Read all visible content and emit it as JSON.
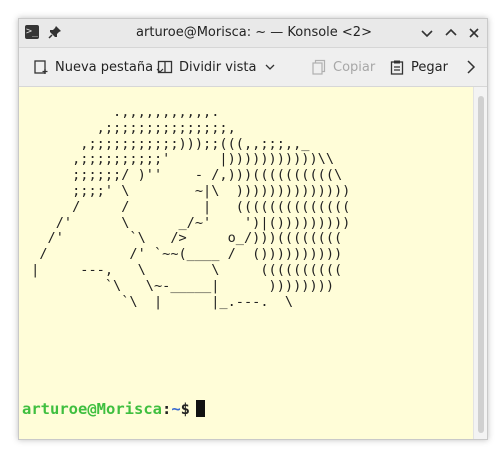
{
  "window": {
    "title": "arturoe@Morisca: ~ — Konsole <2>"
  },
  "toolbar": {
    "new_tab_label": "Nueva pestaña",
    "split_view_label": "Dividir vista",
    "copy_label": "Copiar",
    "paste_label": "Pegar"
  },
  "terminal": {
    "ascii_art": "           .,,,,,,,,,,,.\n         ,;;;;;;;;;;;;;;;,\n       ,;;;;;;;;;;;)));;(((,,;;;,,_\n      ,;;;;;;;;;;'      |)))))))))))\\\\\n      ;;;;;;/ )''    - /,)))((((((((((\\\n      ;;;;' \\        ~|\\  ))))))))))))))\n      /     /         |   ((((((((((((((\n    /'      \\      _/~'    ')|()))))))))\n   /'        `\\   />     o_/)))((((((((\n  /          /' `~~(____ /  ())))))))))\n |     ---,   \\        \\     ((((((((((\n          `\\   \\~-_____|      ))))))))\n            `\\  |      |_.---.  \\",
    "prompt_user": "arturoe@Morisca",
    "prompt_colon": ":",
    "prompt_path": "~",
    "prompt_symbol": "$"
  },
  "colors": {
    "terminal_bg": "#fffdd8",
    "prompt_user": "#3fbf3f",
    "prompt_path": "#3a6ad0"
  },
  "icons": [
    "terminal-app-icon",
    "pin-icon",
    "minimize-icon",
    "maximize-icon",
    "close-icon",
    "new-tab-icon",
    "split-view-icon",
    "copy-icon",
    "paste-icon",
    "chevron-right-icon"
  ]
}
